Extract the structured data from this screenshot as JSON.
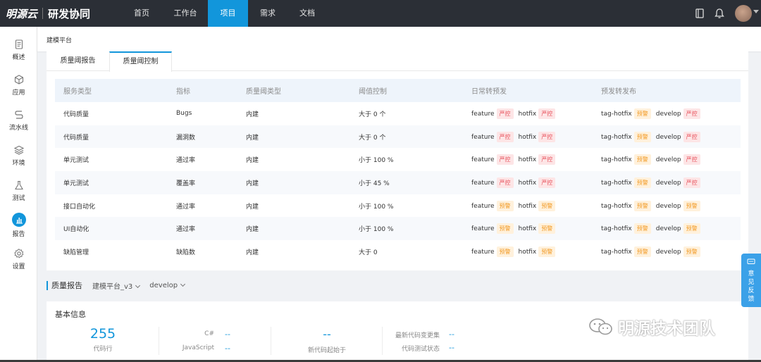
{
  "brand": {
    "logo": "明源云",
    "product": "研发协同"
  },
  "nav": [
    {
      "label": "首页",
      "active": false
    },
    {
      "label": "工作台",
      "active": false
    },
    {
      "label": "项目",
      "active": true
    },
    {
      "label": "需求",
      "active": false
    },
    {
      "label": "文档",
      "active": false
    }
  ],
  "topbar_icons": [
    "book-icon",
    "bell-icon",
    "avatar"
  ],
  "sidebar": [
    {
      "label": "概述",
      "icon": "document-icon"
    },
    {
      "label": "应用",
      "icon": "cube-icon"
    },
    {
      "label": "流水线",
      "icon": "pipeline-icon"
    },
    {
      "label": "环境",
      "icon": "layers-icon"
    },
    {
      "label": "测试",
      "icon": "flask-icon"
    },
    {
      "label": "报告",
      "icon": "bar-chart-icon",
      "active": true
    },
    {
      "label": "设置",
      "icon": "gear-icon"
    }
  ],
  "breadcrumb": "建模平台",
  "tabs": [
    {
      "label": "质量阈报告",
      "active": false
    },
    {
      "label": "质量阈控制",
      "active": true
    }
  ],
  "table": {
    "headers": [
      "服务类型",
      "指标",
      "质量阈类型",
      "阈值控制",
      "日常转预发",
      "预发转发布"
    ],
    "rows": [
      {
        "service": "代码质量",
        "metric": "Bugs",
        "type": "内建",
        "threshold": "大于 0 个",
        "daily": [
          [
            "feature",
            "严控"
          ],
          [
            "hotfix",
            "严控"
          ]
        ],
        "pre": [
          [
            "tag-hotfix",
            "预警"
          ],
          [
            "develop",
            "严控"
          ]
        ]
      },
      {
        "service": "代码质量",
        "metric": "漏洞数",
        "type": "内建",
        "threshold": "大于 0 个",
        "daily": [
          [
            "feature",
            "严控"
          ],
          [
            "hotfix",
            "严控"
          ]
        ],
        "pre": [
          [
            "tag-hotfix",
            "预警"
          ],
          [
            "develop",
            "严控"
          ]
        ]
      },
      {
        "service": "单元测试",
        "metric": "通过率",
        "type": "内建",
        "threshold": "小于 100 %",
        "daily": [
          [
            "feature",
            "严控"
          ],
          [
            "hotfix",
            "严控"
          ]
        ],
        "pre": [
          [
            "tag-hotfix",
            "预警"
          ],
          [
            "develop",
            "严控"
          ]
        ]
      },
      {
        "service": "单元测试",
        "metric": "覆盖率",
        "type": "内建",
        "threshold": "小于 45 %",
        "daily": [
          [
            "feature",
            "严控"
          ],
          [
            "hotfix",
            "严控"
          ]
        ],
        "pre": [
          [
            "tag-hotfix",
            "预警"
          ],
          [
            "develop",
            "严控"
          ]
        ]
      },
      {
        "service": "接口自动化",
        "metric": "通过率",
        "type": "内建",
        "threshold": "小于 100 %",
        "daily": [
          [
            "feature",
            "预警"
          ],
          [
            "hotfix",
            "预警"
          ]
        ],
        "pre": [
          [
            "tag-hotfix",
            "预警"
          ],
          [
            "develop",
            "预警"
          ]
        ]
      },
      {
        "service": "UI自动化",
        "metric": "通过率",
        "type": "内建",
        "threshold": "小于 100 %",
        "daily": [
          [
            "feature",
            "预警"
          ],
          [
            "hotfix",
            "预警"
          ]
        ],
        "pre": [
          [
            "tag-hotfix",
            "预警"
          ],
          [
            "develop",
            "预警"
          ]
        ]
      },
      {
        "service": "缺陷管理",
        "metric": "缺陷数",
        "type": "内建",
        "threshold": "大于 0",
        "daily": [
          [
            "feature",
            "预警"
          ],
          [
            "hotfix",
            "预警"
          ]
        ],
        "pre": [
          [
            "tag-hotfix",
            "预警"
          ],
          [
            "develop",
            "预警"
          ]
        ]
      }
    ]
  },
  "report": {
    "title": "质量报告",
    "project_select": "建模平台_v3",
    "branch_select": "develop",
    "basic_title": "基本信息",
    "code_lines": {
      "value": "255",
      "label": "代码行"
    },
    "languages": [
      {
        "key": "C#",
        "value": "--"
      },
      {
        "key": "JavaScript",
        "value": "--"
      }
    ],
    "new_code": {
      "value": "--",
      "label": "新代码起始于"
    },
    "changes": [
      {
        "key": "最新代码变更集",
        "value": "--"
      },
      {
        "key": "代码测试状态",
        "value": "--"
      }
    ]
  },
  "feedback_label": "意见反馈",
  "watermark": "明源技术团队",
  "colors": {
    "primary": "#1296db",
    "strict_bg": "#fde5e6",
    "strict_fg": "#e8505b",
    "warn_bg": "#fff1dc",
    "warn_fg": "#f29a24",
    "topbar": "#2b2f36"
  }
}
